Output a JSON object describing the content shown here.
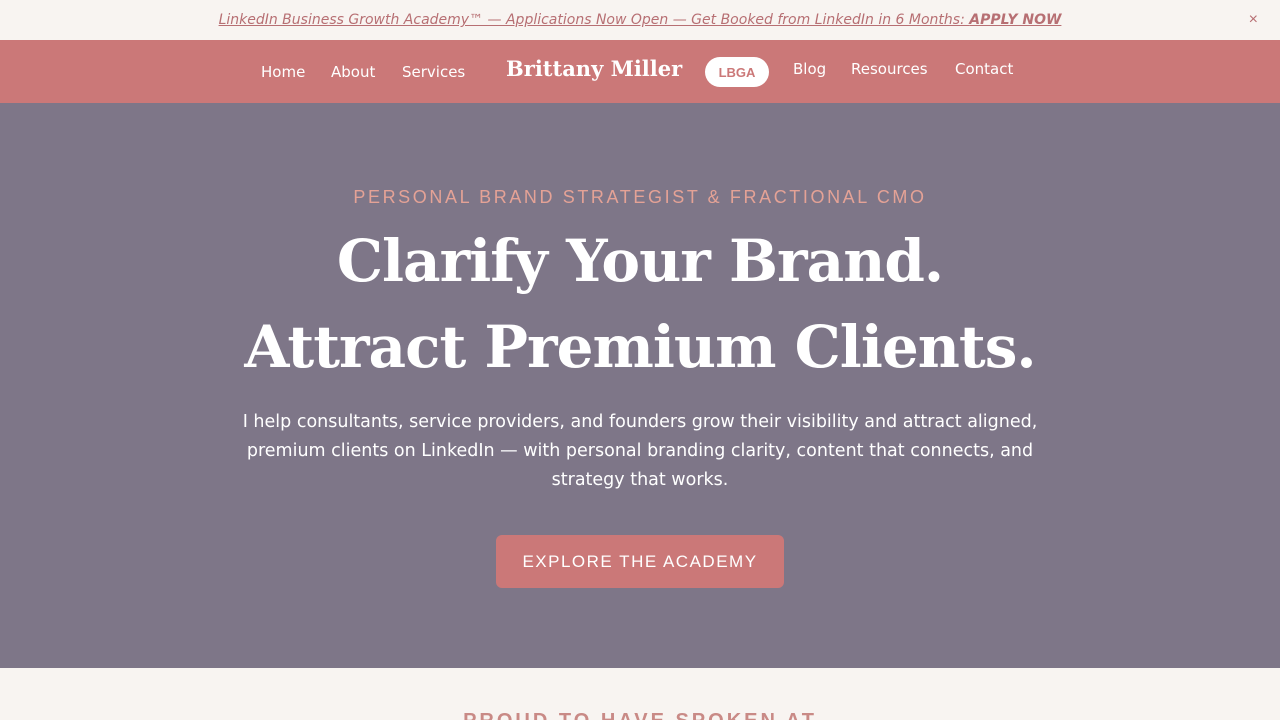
{
  "announcement": {
    "text_prefix": "LinkedIn Business Growth Academy™ — Applications Now Open — Get Booked from LinkedIn in 6 Months: ",
    "cta_text": "APPLY NOW",
    "close_symbol": "×"
  },
  "nav": {
    "left_items": [
      "Home",
      "About",
      "Services"
    ],
    "brand": "Brittany Miller",
    "pill_label": "LBGA",
    "right_items": [
      "Blog",
      "Resources",
      "Contact"
    ]
  },
  "hero": {
    "eyebrow": "PERSONAL BRAND STRATEGIST & FRACTIONAL CMO",
    "headline_line1": "Clarify Your Brand.",
    "headline_line2": "Attract Premium Clients.",
    "description": "I help consultants, service providers, and founders grow their visibility and attract aligned, premium clients on LinkedIn — with personal branding clarity, content that connects, and strategy that works.",
    "cta_label": "EXPLORE THE ACADEMY"
  },
  "next_section": {
    "heading": "PROUD TO HAVE SPOKEN AT"
  },
  "colors": {
    "accent": "#cb7878",
    "hero_bg": "#7e7688",
    "cream": "#f8f4f1",
    "eyebrow": "#e4a296"
  }
}
